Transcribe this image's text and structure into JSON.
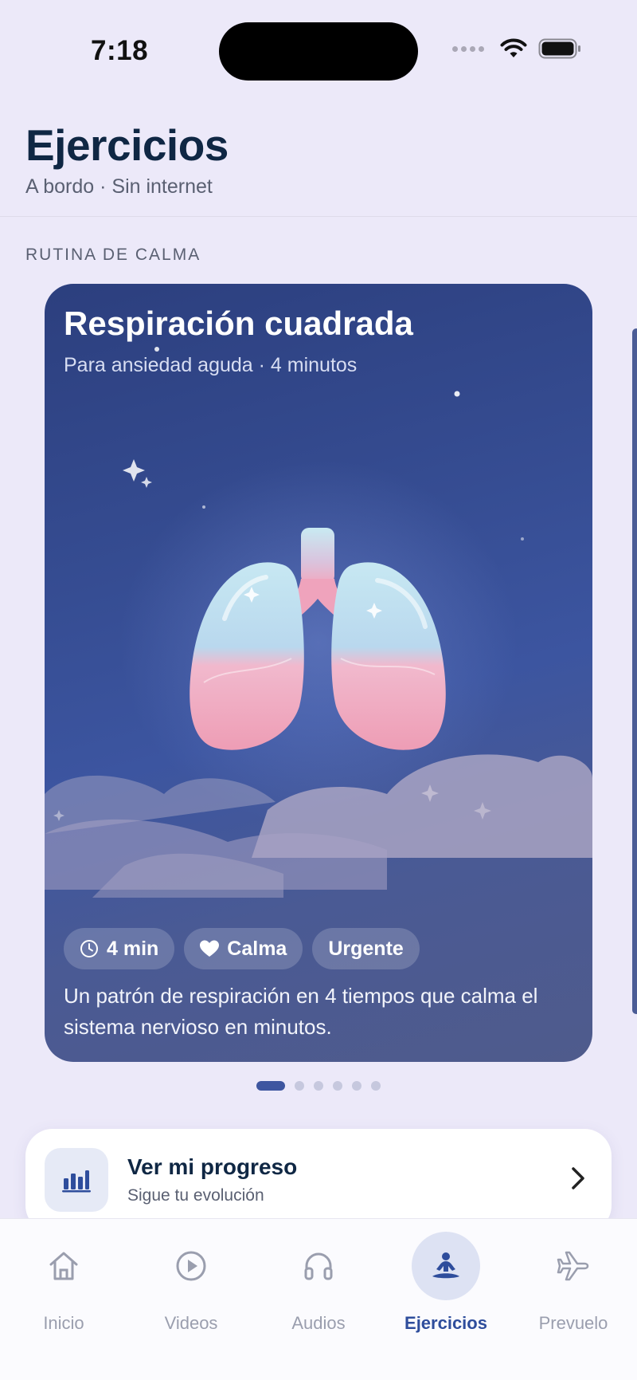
{
  "status_bar": {
    "time": "7:18"
  },
  "header": {
    "title": "Ejercicios",
    "subtitle": "A bordo · Sin internet"
  },
  "section": {
    "label": "RUTINA DE CALMA"
  },
  "card": {
    "title": "Respiración cuadrada",
    "subtitle": "Para ansiedad aguda · 4 minutos",
    "illustration": "lungs-illustration",
    "chips": [
      {
        "icon": "clock-icon",
        "label": "4 min"
      },
      {
        "icon": "heart-icon",
        "label": "Calma"
      },
      {
        "icon": "",
        "label": "Urgente"
      }
    ],
    "description": "Un patrón de respiración en 4 tiempos que calma el sistema nervioso en minutos."
  },
  "pager": {
    "count": 6,
    "active_index": 0
  },
  "progress_card": {
    "icon": "bar-chart-icon",
    "title": "Ver mi progreso",
    "subtitle": "Sigue tu evolución",
    "chevron": "chevron-right-icon"
  },
  "tabbar": {
    "items": [
      {
        "label": "Inicio",
        "icon": "home-icon",
        "active": false
      },
      {
        "label": "Videos",
        "icon": "play-circle-icon",
        "active": false
      },
      {
        "label": "Audios",
        "icon": "headphones-icon",
        "active": false
      },
      {
        "label": "Ejercicios",
        "icon": "meditation-icon",
        "active": true
      },
      {
        "label": "Prevuelo",
        "icon": "airplane-icon",
        "active": false
      }
    ]
  },
  "colors": {
    "background": "#ECE9F9",
    "title": "#0F2744",
    "accent": "#2E4D9C",
    "card_top": "#2C3F7E",
    "card_bottom": "#4F5B8C"
  }
}
